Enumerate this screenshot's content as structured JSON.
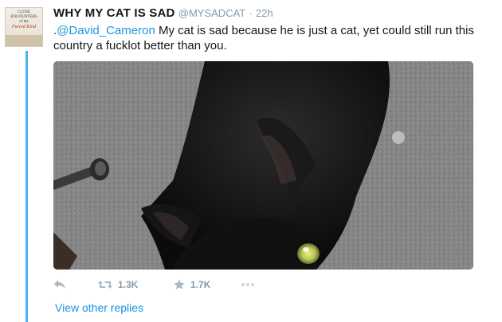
{
  "tweet": {
    "author": {
      "display_name": "WHY MY CAT IS SAD",
      "handle": "@MYSADCAT",
      "avatar_icon": "book-cover-avatar",
      "avatar_book_text": [
        "CLOSE",
        "ENCOUNTERS",
        "of the",
        "Furred Kind"
      ]
    },
    "separator": "·",
    "time": "22h",
    "text": {
      "prefix": ".",
      "mention": "@David_Cameron",
      "body": " My cat is sad because he is just a cat, yet could still run this country a fucklot better than you."
    },
    "actions": {
      "reply_icon": "reply-icon",
      "retweet_icon": "retweet-icon",
      "retweet_count": "1.3K",
      "like_icon": "star-icon",
      "like_count": "1.7K",
      "more_icon": "more-dots-icon"
    },
    "view_other_replies": "View other replies"
  },
  "colors": {
    "accent": "#1b95e0",
    "thread_line": "#4ab3f4",
    "muted": "#8899a6",
    "icon": "#aab8c2"
  }
}
